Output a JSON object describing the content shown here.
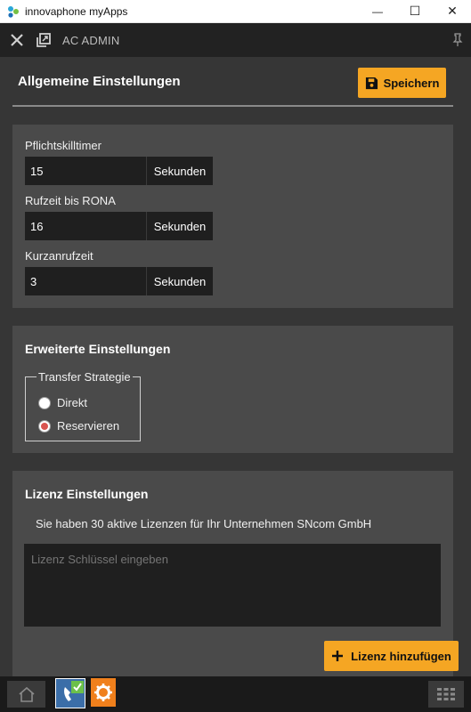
{
  "window": {
    "title": "innovaphone myApps",
    "minimize_glyph": "—",
    "maximize_glyph": "☐",
    "close_glyph": "✕"
  },
  "app_header": {
    "title": "AC ADMIN"
  },
  "page": {
    "title": "Allgemeine Einstellungen",
    "save_label": "Speichern"
  },
  "general": {
    "fields": [
      {
        "label": "Pflichtskilltimer",
        "value": "15",
        "unit": "Sekunden"
      },
      {
        "label": "Rufzeit bis RONA",
        "value": "16",
        "unit": "Sekunden"
      },
      {
        "label": "Kurzanrufzeit",
        "value": "3",
        "unit": "Sekunden"
      }
    ]
  },
  "advanced": {
    "title": "Erweiterte Einstellungen",
    "transfer_legend": "Transfer Strategie",
    "options": [
      {
        "label": "Direkt",
        "checked": false
      },
      {
        "label": "Reservieren",
        "checked": true
      }
    ]
  },
  "license": {
    "title": "Lizenz Einstellungen",
    "info": "Sie haben 30 aktive Lizenzen für Ihr Unternehmen SNcom GmbH",
    "placeholder": "Lizenz Schlüssel eingeben",
    "add_label": "Lizenz hinzufügen"
  },
  "colors": {
    "accent": "#f5a623",
    "background": "#363636",
    "panel": "#4a4a4a",
    "input": "#1f1f1f",
    "radio_checked": "#d9534f"
  },
  "icons": {
    "app_logo": "innovaphone-logo-icon",
    "close": "close-icon",
    "popout": "popout-icon",
    "pin": "pin-icon",
    "save": "floppy-disk-icon",
    "add": "plus-icon",
    "home": "home-icon",
    "app1": "phone-check-app-icon",
    "app2": "gear-app-icon",
    "grid": "app-grid-icon"
  }
}
